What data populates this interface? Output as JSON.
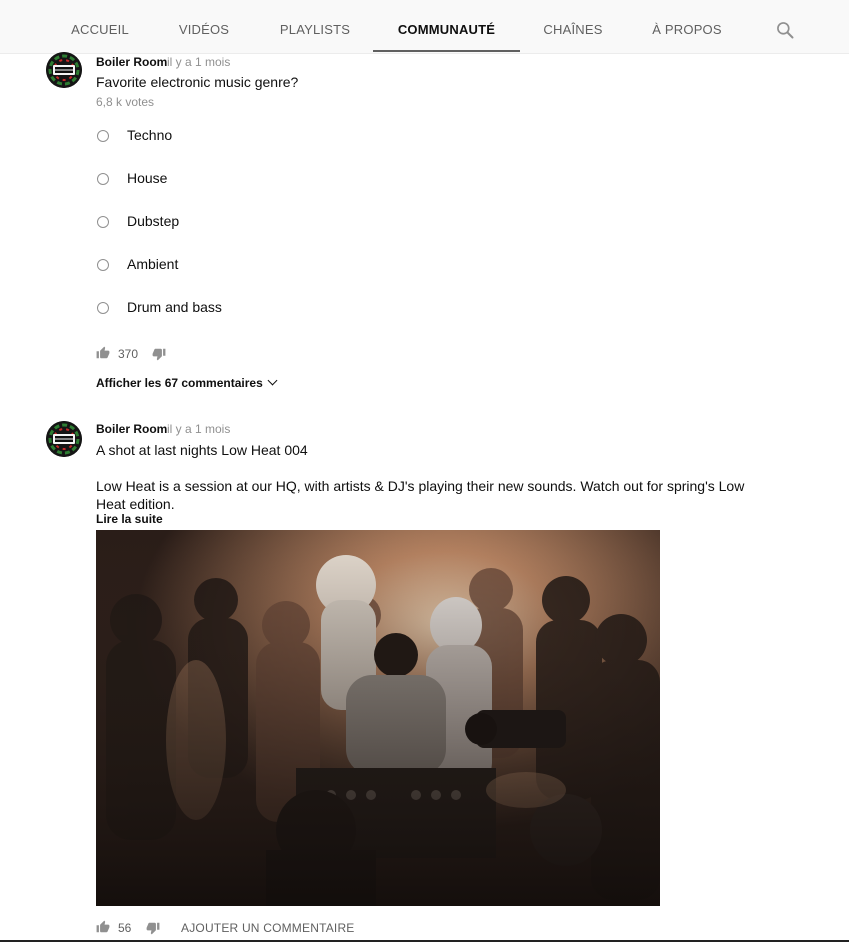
{
  "tabs": [
    {
      "label": "ACCUEIL",
      "active": false
    },
    {
      "label": "VIDÉOS",
      "active": false
    },
    {
      "label": "PLAYLISTS",
      "active": false
    },
    {
      "label": "COMMUNAUTÉ",
      "active": true
    },
    {
      "label": "CHAÎNES",
      "active": false
    },
    {
      "label": "À PROPOS",
      "active": false
    }
  ],
  "search_icon": "search-icon",
  "post1": {
    "author": "Boiler Room",
    "time": "il y a 1 mois",
    "text": "Favorite electronic music genre?",
    "votes": "6,8 k votes",
    "options": [
      "Techno",
      "House",
      "Dubstep",
      "Ambient",
      "Drum and bass"
    ],
    "likes": "370",
    "comments_link": "Afficher les 67 commentaires"
  },
  "post2": {
    "author": "Boiler Room",
    "time": "il y a 1 mois",
    "title": "A shot at last nights Low Heat 004",
    "body": "Low Heat is a session at our HQ, with artists & DJ's playing their new sounds. Watch out for spring's Low Heat edition.",
    "read_more": "Lire la suite",
    "likes": "56",
    "add_comment": "AJOUTER UN COMMENTAIRE"
  },
  "colors": {
    "text_primary": "#0f0f0f",
    "text_secondary": "#606060",
    "text_muted": "#909090",
    "tabbar_bg": "#f9f9f9"
  },
  "avatar_text": "BOILER ROOM"
}
